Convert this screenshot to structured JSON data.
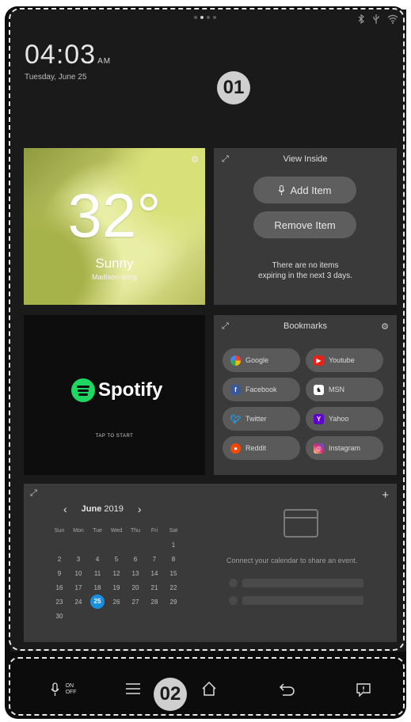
{
  "status": {
    "bluetooth": "bluetooth-icon",
    "usb": "usb-icon",
    "wifi": "wifi-icon"
  },
  "clock": {
    "time": "04:03",
    "ampm": "AM",
    "date": "Tuesday, June 25"
  },
  "callouts": {
    "one": "01",
    "two": "02"
  },
  "weather": {
    "temperature": "32°",
    "condition": "Sunny",
    "location": "Madison-dong"
  },
  "view_inside": {
    "title": "View Inside",
    "add_label": "Add Item",
    "remove_label": "Remove Item",
    "message_line1": "There are no items",
    "message_line2": "expiring in the next 3 days."
  },
  "spotify": {
    "brand": "Spotify",
    "tap": "TAP TO START"
  },
  "bookmarks": {
    "title": "Bookmarks",
    "items": [
      {
        "label": "Google",
        "color": "#4285f4"
      },
      {
        "label": "Youtube",
        "color": "#e62117"
      },
      {
        "label": "Facebook",
        "color": "#3b5998"
      },
      {
        "label": "MSN",
        "color": "#ffffff"
      },
      {
        "label": "Twitter",
        "color": "#1da1f2"
      },
      {
        "label": "Yahoo",
        "color": "#6001d2"
      },
      {
        "label": "Reddit",
        "color": "#ff4500"
      },
      {
        "label": "Instagram",
        "color": "#e1306c"
      }
    ]
  },
  "calendar": {
    "month": "June",
    "year": "2019",
    "weekdays": [
      "Sun",
      "Mon",
      "Tue",
      "Wed",
      "Thu",
      "Fri",
      "Sat"
    ],
    "days": [
      "",
      "",
      "",
      "",
      "",
      "",
      "1",
      "2",
      "3",
      "4",
      "5",
      "6",
      "7",
      "8",
      "9",
      "10",
      "11",
      "12",
      "13",
      "14",
      "15",
      "16",
      "17",
      "18",
      "19",
      "20",
      "21",
      "22",
      "23",
      "24",
      "25",
      "26",
      "27",
      "28",
      "29",
      "30"
    ],
    "today": "25",
    "connect_message": "Connect your calendar to share an event.",
    "accent": "#1a8fe0"
  },
  "navbar": {
    "voice_on": "ON",
    "voice_off": "OFF"
  }
}
